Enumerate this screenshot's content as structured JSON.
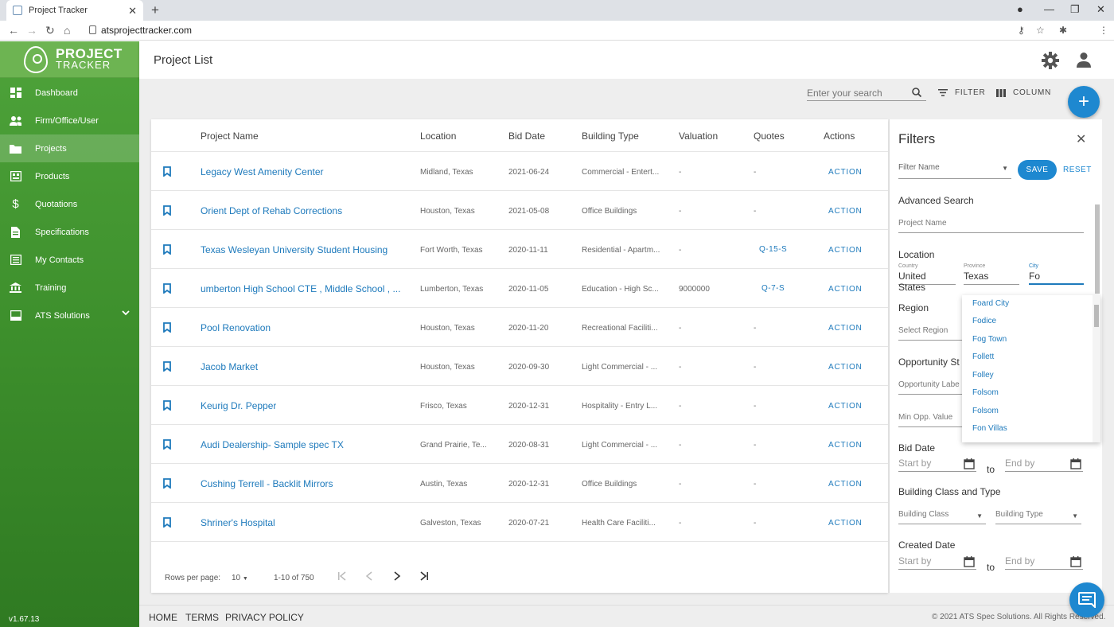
{
  "browser": {
    "tab_title": "Project Tracker",
    "url": "atsprojecttracker.com"
  },
  "app": {
    "logo_line1": "PROJECT",
    "logo_line2": "TRACKER",
    "version": "v1.67.13",
    "brand_color": "#4ea33a",
    "accent_color": "#1e88d0"
  },
  "sidebar": {
    "items": [
      {
        "label": "Dashboard",
        "icon": "dashboard-icon"
      },
      {
        "label": "Firm/Office/User",
        "icon": "people-icon"
      },
      {
        "label": "Projects",
        "icon": "folder-icon",
        "active": true
      },
      {
        "label": "Products",
        "icon": "products-icon"
      },
      {
        "label": "Quotations",
        "icon": "dollar-icon"
      },
      {
        "label": "Specifications",
        "icon": "document-icon"
      },
      {
        "label": "My Contacts",
        "icon": "contacts-icon"
      },
      {
        "label": "Training",
        "icon": "institution-icon"
      },
      {
        "label": "ATS Solutions",
        "icon": "book-icon",
        "expandable": true
      }
    ]
  },
  "header": {
    "title": "Project List"
  },
  "toolbar": {
    "search_placeholder": "Enter your search",
    "filter_label": "FILTER",
    "column_label": "COLUMN",
    "add_label": "+"
  },
  "table": {
    "headers": {
      "project_name": "Project Name",
      "location": "Location",
      "bid_date": "Bid Date",
      "building_type": "Building Type",
      "valuation": "Valuation",
      "quotes": "Quotes",
      "actions": "Actions"
    },
    "rows": [
      {
        "name": "Legacy West Amenity Center",
        "location": "Midland, Texas",
        "bid_date": "2021-06-24",
        "building_type": "Commercial - Entert...",
        "valuation": "-",
        "quotes": "-",
        "action": "ACTION"
      },
      {
        "name": "Orient Dept of Rehab Corrections",
        "location": "Houston, Texas",
        "bid_date": "2021-05-08",
        "building_type": "Office Buildings",
        "valuation": "-",
        "quotes": "-",
        "action": "ACTION"
      },
      {
        "name": "Texas Wesleyan University Student Housing",
        "location": "Fort Worth, Texas",
        "bid_date": "2020-11-11",
        "building_type": "Residential - Apartm...",
        "valuation": "-",
        "quotes": "Q-15-S",
        "action": "ACTION"
      },
      {
        "name": "umberton High School CTE , Middle School , ...",
        "location": "Lumberton, Texas",
        "bid_date": "2020-11-05",
        "building_type": "Education - High Sc...",
        "valuation": "9000000",
        "quotes": "Q-7-S",
        "action": "ACTION"
      },
      {
        "name": "Pool Renovation",
        "location": "Houston, Texas",
        "bid_date": "2020-11-20",
        "building_type": "Recreational Faciliti...",
        "valuation": "-",
        "quotes": "-",
        "action": "ACTION"
      },
      {
        "name": "Jacob Market",
        "location": "Houston, Texas",
        "bid_date": "2020-09-30",
        "building_type": "Light Commercial - ...",
        "valuation": "-",
        "quotes": "-",
        "action": "ACTION"
      },
      {
        "name": "Keurig Dr. Pepper",
        "location": "Frisco, Texas",
        "bid_date": "2020-12-31",
        "building_type": "Hospitality - Entry L...",
        "valuation": "-",
        "quotes": "-",
        "action": "ACTION"
      },
      {
        "name": "Audi Dealership- Sample spec TX",
        "location": "Grand Prairie, Te...",
        "bid_date": "2020-08-31",
        "building_type": "Light Commercial - ...",
        "valuation": "-",
        "quotes": "-",
        "action": "ACTION"
      },
      {
        "name": "Cushing Terrell - Backlit Mirrors",
        "location": "Austin, Texas",
        "bid_date": "2020-12-31",
        "building_type": "Office Buildings",
        "valuation": "-",
        "quotes": "-",
        "action": "ACTION"
      },
      {
        "name": "Shriner's Hospital",
        "location": "Galveston, Texas",
        "bid_date": "2020-07-21",
        "building_type": "Health Care Faciliti...",
        "valuation": "-",
        "quotes": "-",
        "action": "ACTION"
      }
    ]
  },
  "pagination": {
    "rows_per_page_label": "Rows per page:",
    "rows_per_page_value": "10",
    "range": "1-10 of 750"
  },
  "filters": {
    "title": "Filters",
    "filter_name_placeholder": "Filter Name",
    "save_label": "SAVE",
    "reset_label": "RESET",
    "advanced_search_label": "Advanced Search",
    "project_name_placeholder": "Project Name",
    "location_label": "Location",
    "country_label": "Country",
    "country_value": "United States",
    "province_label": "Province",
    "province_value": "Texas",
    "city_label": "City",
    "city_value": "Fo",
    "region_label": "Region",
    "region_placeholder": "Select Region",
    "opportunity_label": "Opportunity St",
    "opportunity_label_placeholder": "Opportunity Labe",
    "min_opp_placeholder": "Min Opp. Value",
    "bid_date_label": "Bid Date",
    "start_by": "Start by",
    "end_by": "End by",
    "to": "to",
    "building_class_type_label": "Building Class and Type",
    "building_class_placeholder": "Building Class",
    "building_type_placeholder": "Building Type",
    "created_date_label": "Created Date",
    "city_options": [
      "Foard City",
      "Fodice",
      "Fog Town",
      "Follett",
      "Folley",
      "Folsom",
      "Folsom",
      "Fon Villas"
    ]
  },
  "footer": {
    "home": "HOME",
    "terms": "TERMS",
    "privacy": "PRIVACY POLICY",
    "copyright": "© 2021 ATS Spec Solutions. All Rights Reserved."
  }
}
